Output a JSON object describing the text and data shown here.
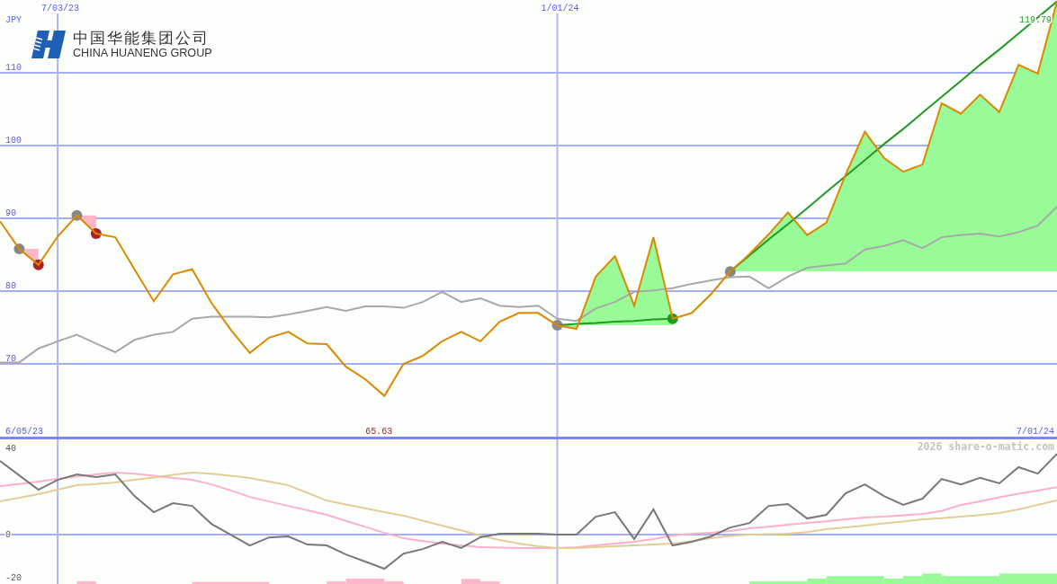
{
  "logo": {
    "name_zh": "中国华能集团公司",
    "name_en": "CHINA HUANENG GROUP"
  },
  "price_chart": {
    "chart_data": {
      "type": "line",
      "ylabel": "JPY",
      "grid": true,
      "categories": [
        null,
        null,
        null,
        "7/03/23",
        null,
        null,
        null,
        null,
        null,
        null,
        null,
        null,
        null,
        null,
        null,
        null,
        null,
        null,
        null,
        null,
        null,
        null,
        null,
        null,
        null,
        null,
        null,
        null,
        null,
        "1/01/24",
        null,
        null,
        null,
        null,
        null,
        null,
        null,
        null,
        null,
        null,
        null,
        null,
        null,
        null,
        null,
        null,
        null,
        null,
        null,
        null,
        null,
        null,
        null,
        null,
        null,
        null
      ],
      "ylim": [
        60,
        120
      ],
      "yticks": [
        70,
        80,
        90,
        100,
        110
      ],
      "series": [
        {
          "color": "#dd8800",
          "values": [
            89.6,
            85.8,
            83.6,
            87.5,
            90.4,
            87.9,
            87.4,
            83.0,
            78.6,
            82.3,
            83.0,
            78.4,
            74.7,
            71.5,
            73.6,
            74.4,
            72.8,
            72.7,
            69.6,
            67.9,
            65.6,
            70.0,
            71.1,
            73.1,
            74.4,
            73.1,
            75.8,
            77.0,
            77.0,
            75.3,
            74.8,
            82.0,
            84.8,
            78.0,
            87.4,
            76.2,
            77.0,
            79.6,
            82.7,
            85.1,
            87.8,
            90.8,
            87.7,
            89.4,
            96.0,
            101.9,
            98.3,
            96.4,
            97.4,
            105.8,
            104.4,
            107.0,
            104.6,
            111.1,
            109.9,
            119.8
          ]
        },
        {
          "color": "#a8a8a8",
          "values": [
            70.2,
            70.2,
            72.1,
            73.1,
            74.0,
            72.8,
            71.6,
            73.3,
            74.0,
            74.4,
            76.2,
            76.5,
            76.5,
            76.5,
            76.4,
            76.8,
            77.3,
            77.8,
            77.3,
            77.9,
            77.9,
            77.7,
            78.5,
            79.9,
            78.5,
            79.0,
            78.0,
            77.8,
            78.0,
            76.2,
            75.9,
            77.6,
            78.5,
            79.9,
            80.1,
            80.4,
            81.0,
            81.5,
            81.9,
            82.0,
            80.4,
            82.0,
            83.2,
            83.5,
            83.8,
            85.7,
            86.2,
            87.0,
            85.9,
            87.4,
            87.7,
            87.9,
            87.5,
            88.1,
            89.0,
            91.6
          ]
        },
        {
          "color": "#229922",
          "values": [
            null,
            null,
            null,
            null,
            null,
            null,
            null,
            null,
            null,
            null,
            null,
            null,
            null,
            null,
            null,
            null,
            null,
            null,
            null,
            null,
            null,
            null,
            null,
            null,
            null,
            null,
            null,
            null,
            null,
            75.3,
            75.5,
            75.6,
            75.8,
            75.9,
            76.1,
            76.2,
            null,
            null,
            82.7,
            84.9,
            87.1,
            89.2,
            91.4,
            93.6,
            95.8,
            98.0,
            100.2,
            102.3,
            104.5,
            106.7,
            108.9,
            111.1,
            113.2,
            115.4,
            117.6,
            119.8
          ]
        }
      ],
      "annotations": [
        "119.79",
        "65.63"
      ]
    }
  },
  "period": {
    "start": "6/05/23",
    "end": "7/01/24"
  },
  "indicator_chart": {
    "chart_data": {
      "type": "line",
      "categories": [
        null,
        null,
        null,
        null,
        null,
        null,
        null,
        null,
        null,
        null,
        null,
        null,
        null,
        null,
        null,
        null,
        null,
        null,
        null,
        null,
        null,
        null,
        null,
        null,
        null,
        null,
        null,
        null,
        null,
        null,
        null,
        null,
        null,
        null,
        null,
        null,
        null,
        null,
        null,
        null,
        null,
        null,
        null,
        null,
        null,
        null,
        null,
        null,
        null,
        null,
        null,
        null,
        null,
        null,
        null,
        null
      ],
      "ylim": [
        -22.9,
        44.2
      ],
      "yticks": [
        40,
        0,
        -20
      ],
      "ref_lines": [
        {
          "axis": "y",
          "value": 0
        }
      ],
      "series": [
        {
          "color": "#787878",
          "values": [
            34.2,
            27.5,
            20.8,
            25.4,
            27.9,
            26.7,
            27.9,
            17.9,
            10.4,
            14.6,
            13.3,
            5.0,
            0.0,
            -5.0,
            -1.3,
            -0.8,
            -4.6,
            -5.0,
            -9.2,
            -12.5,
            -15.8,
            -8.8,
            -6.7,
            -3.3,
            -6.2,
            -1.2,
            0.4,
            0.4,
            0.4,
            0.0,
            0.0,
            8.3,
            10.4,
            -2.0,
            11.7,
            -5.0,
            -3.3,
            -0.8,
            3.3,
            5.4,
            13.3,
            14.2,
            7.5,
            9.2,
            19.2,
            23.3,
            17.9,
            13.8,
            16.7,
            25.8,
            23.3,
            26.3,
            23.8,
            31.3,
            28.3,
            37.5
          ]
        },
        {
          "color": "#ffb0c8",
          "values": [
            22.5,
            23.5,
            24.6,
            25.8,
            27.0,
            28.0,
            28.8,
            28.3,
            27.3,
            26.3,
            25.4,
            23.3,
            20.5,
            17.5,
            15.4,
            13.3,
            11.3,
            9.2,
            6.4,
            3.6,
            0.8,
            -1.7,
            -3.0,
            -4.2,
            -5.0,
            -5.8,
            -6.0,
            -6.2,
            -6.2,
            -6.2,
            -5.8,
            -5.0,
            -4.2,
            -3.3,
            -2.0,
            -0.4,
            0.4,
            0.8,
            1.7,
            2.9,
            3.7,
            4.6,
            5.4,
            6.2,
            7.1,
            7.9,
            8.3,
            9.0,
            9.6,
            11.0,
            13.8,
            15.5,
            17.3,
            19.0,
            20.5,
            22.0
          ]
        },
        {
          "color": "#e2cc98",
          "values": [
            15.4,
            17.1,
            18.8,
            20.8,
            22.9,
            23.5,
            24.2,
            25.4,
            26.5,
            27.7,
            28.8,
            28.3,
            27.3,
            26.3,
            24.6,
            22.9,
            19.4,
            15.8,
            14.0,
            12.2,
            10.4,
            8.8,
            6.5,
            4.2,
            2.0,
            -0.4,
            -2.5,
            -4.2,
            -5.4,
            -6.2,
            -6.2,
            -5.8,
            -5.4,
            -5.0,
            -4.6,
            -4.2,
            -3.0,
            -1.7,
            -0.6,
            0.0,
            0.2,
            0.4,
            1.2,
            2.5,
            3.3,
            4.2,
            5.2,
            6.1,
            7.1,
            7.6,
            8.3,
            9.1,
            10.0,
            11.7,
            13.8,
            15.8
          ]
        }
      ]
    }
  },
  "credit": "2026 share-o-matic.com"
}
